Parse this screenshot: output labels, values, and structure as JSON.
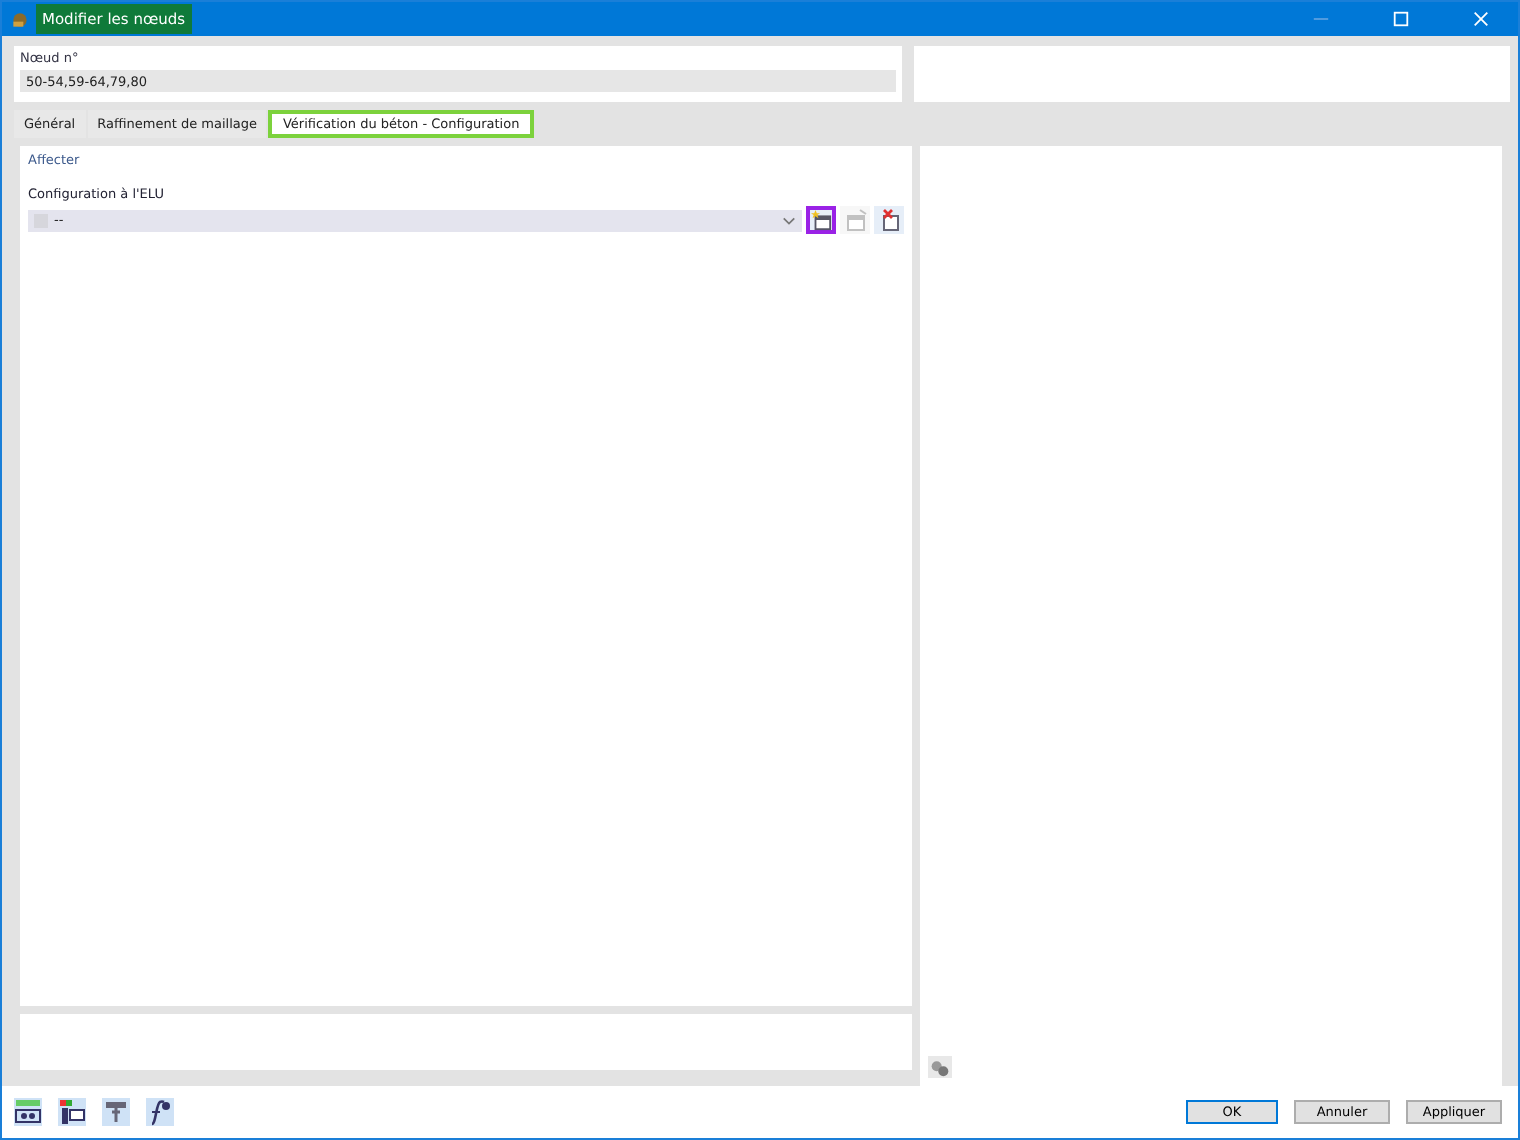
{
  "window": {
    "title": "Modifier les nœuds"
  },
  "node_field": {
    "label": "Nœud n°",
    "value": "50-54,59-64,79,80"
  },
  "tabs": [
    {
      "label": "Général",
      "selected": false
    },
    {
      "label": "Raffinement de maillage",
      "selected": false
    },
    {
      "label": "Vérification du béton - Configuration",
      "selected": true
    }
  ],
  "section": {
    "title": "Affecter"
  },
  "uls_config": {
    "label": "Configuration à l'ELU",
    "value": "--"
  },
  "field_buttons": [
    {
      "kind": "new",
      "highlighted": true,
      "disabled": false
    },
    {
      "kind": "edit",
      "highlighted": false,
      "disabled": true
    },
    {
      "kind": "delete",
      "highlighted": false,
      "disabled": false
    }
  ],
  "buttons": [
    {
      "label": "OK",
      "default": true
    },
    {
      "label": "Annuler",
      "default": false
    },
    {
      "label": "Appliquer",
      "default": false
    }
  ]
}
